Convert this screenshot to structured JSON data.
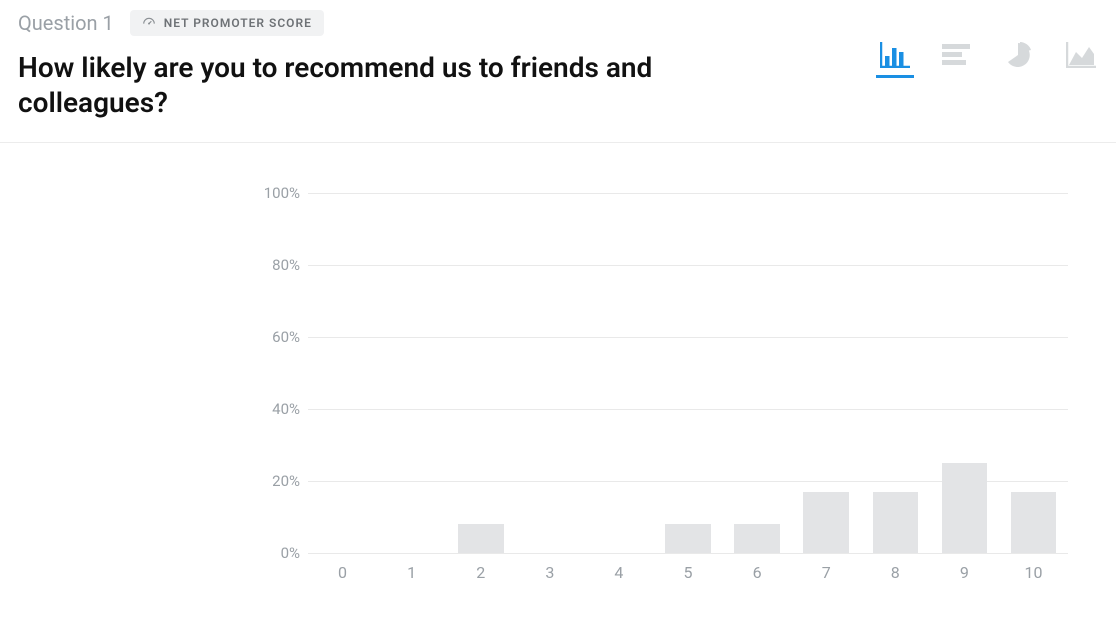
{
  "header": {
    "question_label": "Question 1",
    "badge_label": "NET PROMOTER SCORE",
    "question_text": "How likely are you to recommend us to friends and colleagues?"
  },
  "toolbar": {
    "bar_chart": "Bar chart",
    "hbar_chart": "Horizontal bar chart",
    "pie_chart": "Pie chart",
    "area_chart": "Area chart",
    "active": "bar_chart"
  },
  "chart_data": {
    "type": "bar",
    "title": "",
    "xlabel": "",
    "ylabel": "",
    "categories": [
      "0",
      "1",
      "2",
      "3",
      "4",
      "5",
      "6",
      "7",
      "8",
      "9",
      "10"
    ],
    "values": [
      0,
      0,
      8,
      0,
      0,
      8,
      8,
      17,
      17,
      25,
      17
    ],
    "y_ticks": [
      "0%",
      "20%",
      "40%",
      "60%",
      "80%",
      "100%"
    ],
    "ylim": [
      0,
      100
    ],
    "grid": true,
    "unit": "%"
  }
}
